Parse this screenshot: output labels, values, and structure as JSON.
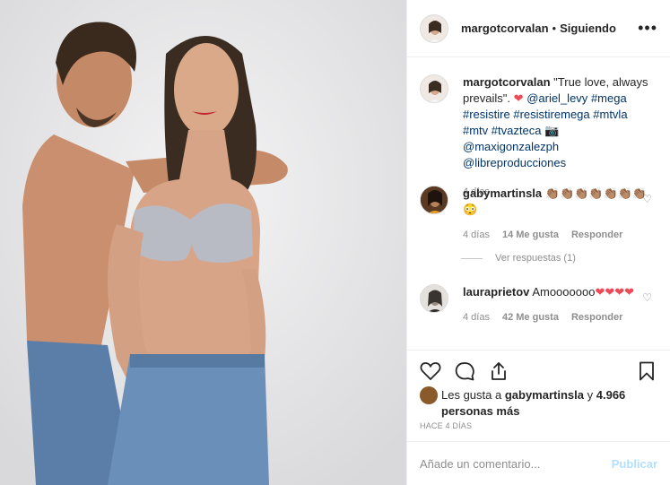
{
  "header": {
    "username": "margotcorvalan",
    "separator": "•",
    "follow_status": "Siguiendo",
    "more_icon": "more-options-icon",
    "more_label": "•••"
  },
  "caption": {
    "username": "margotcorvalan",
    "text_1": "\"True love, always prevails\".",
    "heart": "❤",
    "tag_1": "@ariel_levy",
    "tag_2": "#mega",
    "tag_3": "#resistire",
    "tag_4": "#resistiremega",
    "tag_5": "#mtvla",
    "tag_6": "#mtv",
    "tag_7": "#tvazteca",
    "camera": "📷",
    "tag_8": "@maxigonzalezph",
    "tag_9": "@libreproducciones",
    "time": "4 días"
  },
  "comments": [
    {
      "username": "gabymartinsla",
      "text": "👏🏽👏🏽👏🏽👏🏽👏🏽👏🏽👏🏽😳",
      "time": "4 días",
      "likes": "14 Me gusta",
      "reply": "Responder",
      "view_replies": "Ver respuestas (1)"
    },
    {
      "username": "lauraprietov",
      "text": "Amooooooo",
      "hearts": "❤❤❤❤",
      "time": "4 días",
      "likes": "42 Me gusta",
      "reply": "Responder"
    }
  ],
  "likes": {
    "prefix": "Les gusta a",
    "user": "gabymartinsla",
    "middle": "y",
    "count": "4.966 personas más"
  },
  "timestamp": "HACE 4 DÍAS",
  "add_comment": {
    "placeholder": "Añade un comentario...",
    "post_label": "Publicar"
  },
  "colors": {
    "link": "#003569",
    "muted": "#8e8e8e",
    "post_disabled": "#b2dffc",
    "heart_red": "#ed4956"
  }
}
